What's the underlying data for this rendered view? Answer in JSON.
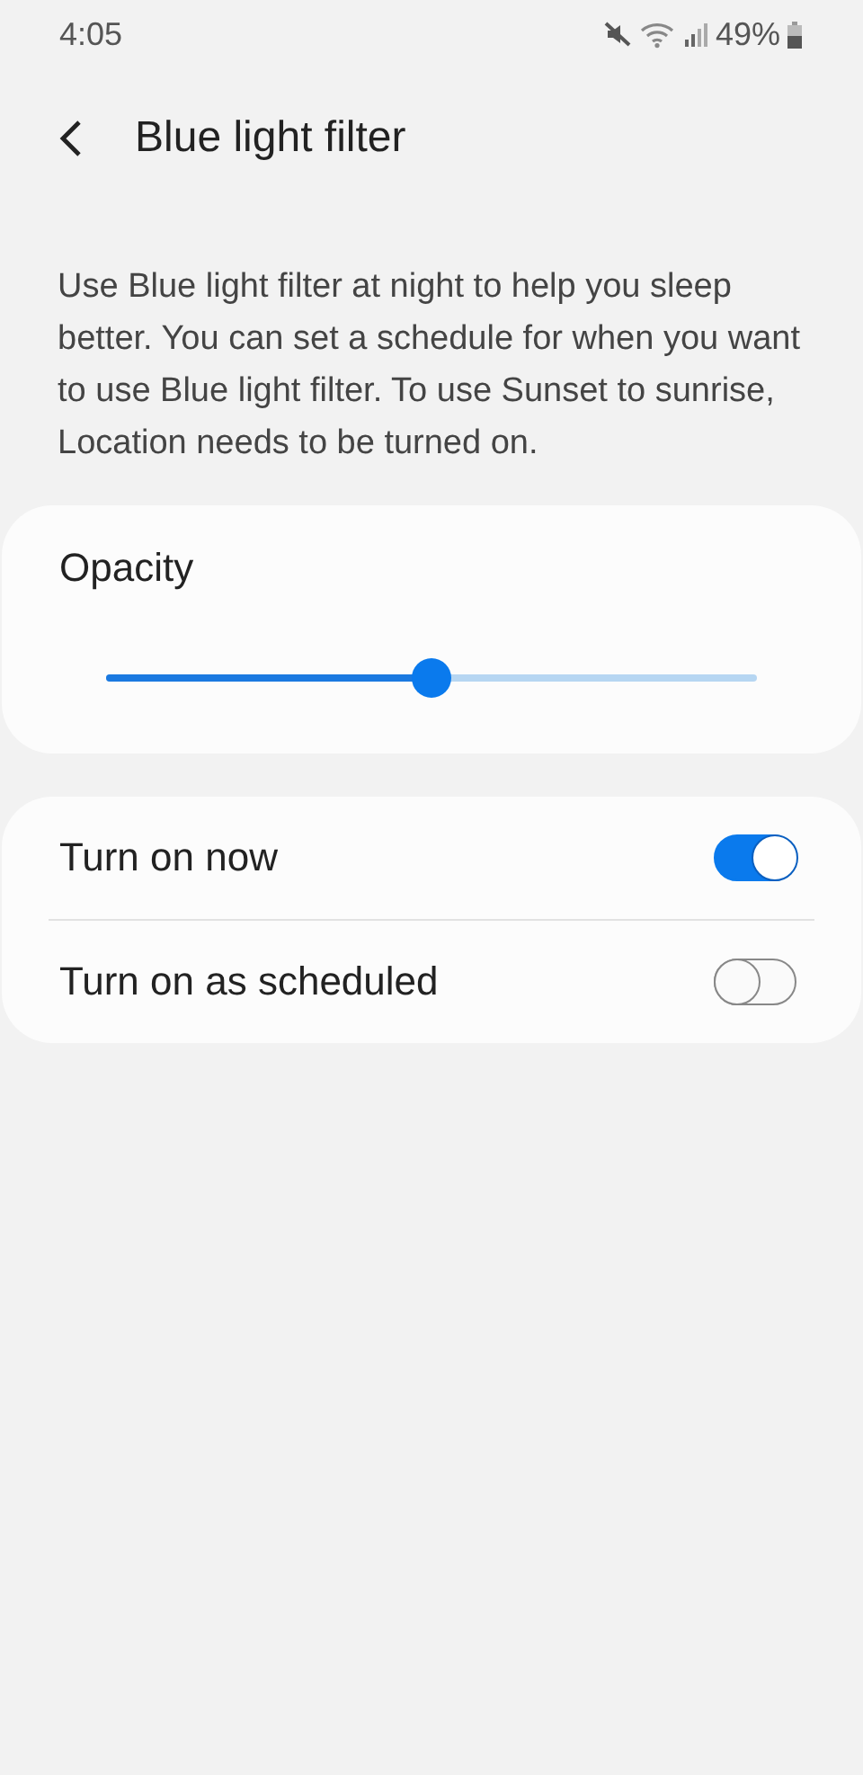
{
  "status_bar": {
    "time": "4:05",
    "battery_text": "49%"
  },
  "header": {
    "title": "Blue light filter"
  },
  "description": "Use Blue light filter at night to help you sleep better. You can set a schedule for when you want to use Blue light filter. To use Sunset to sunrise, Location needs to be turned on.",
  "opacity": {
    "label": "Opacity",
    "level": 0.5
  },
  "switches": [
    {
      "label": "Turn on now",
      "on": true
    },
    {
      "label": "Turn on as scheduled",
      "on": false
    }
  ]
}
